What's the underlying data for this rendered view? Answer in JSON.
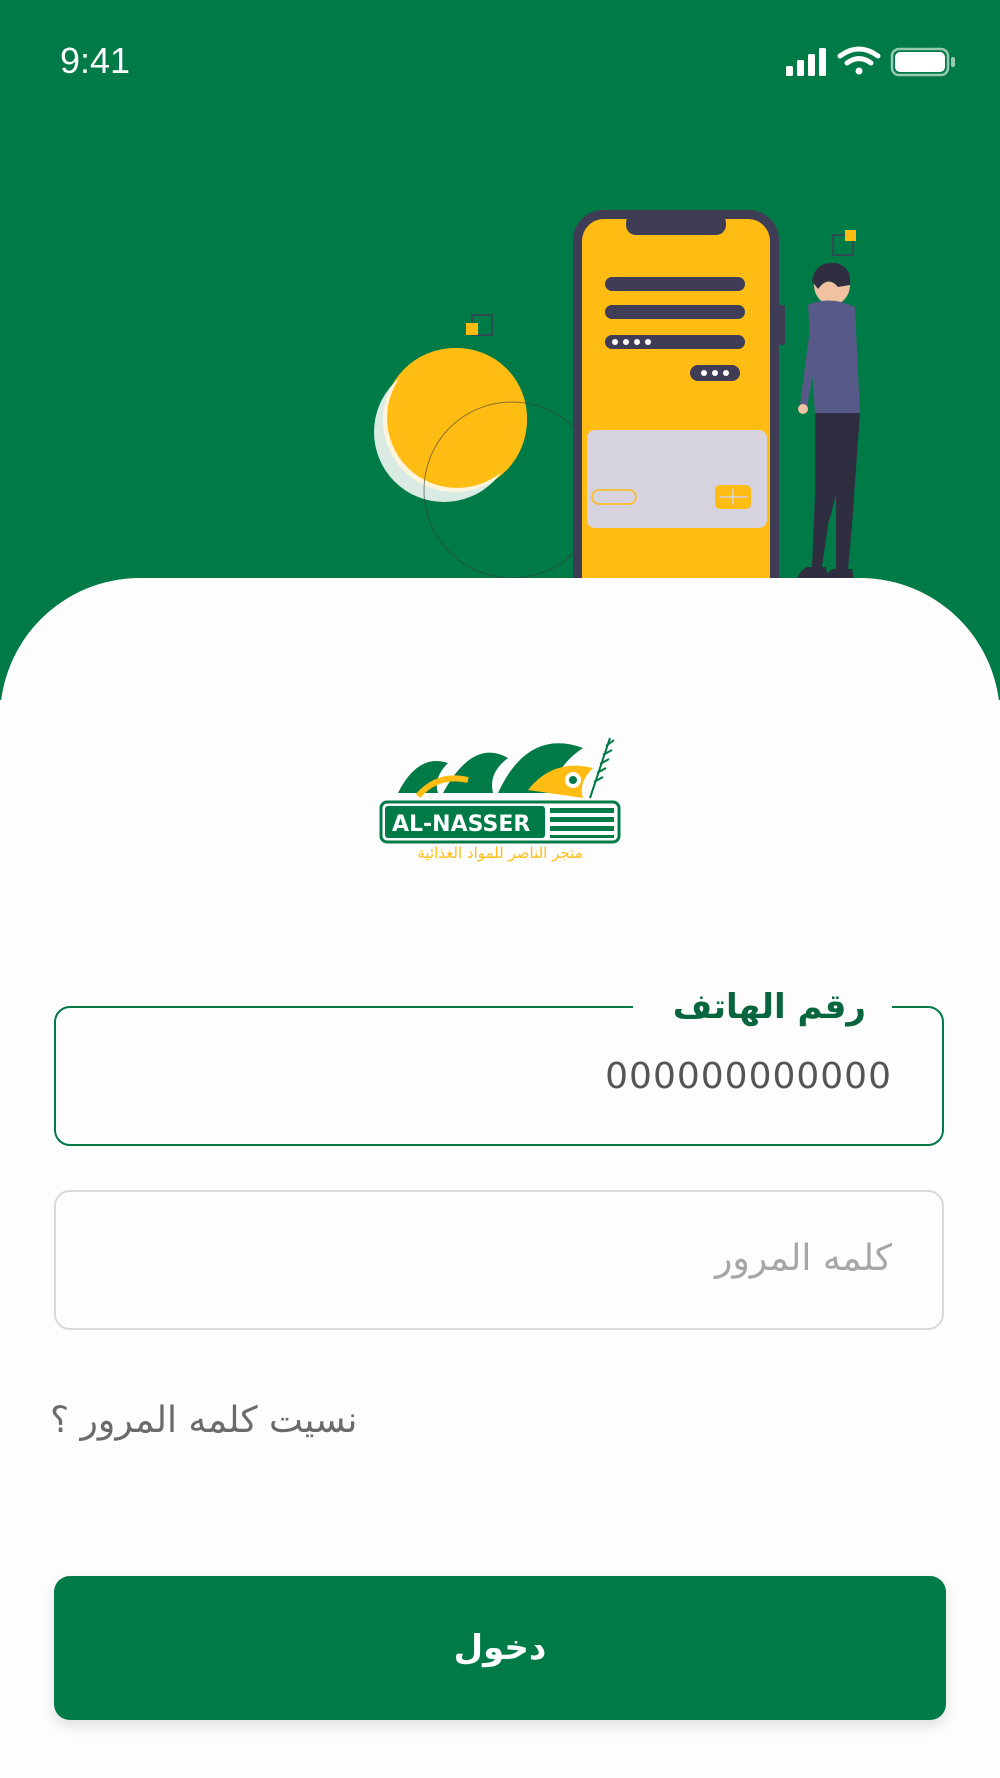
{
  "status_bar": {
    "time": "9:41",
    "icons": [
      "signal-icon",
      "wifi-icon",
      "battery-icon"
    ]
  },
  "hero": {
    "illustration": "phone-login-illustration"
  },
  "logo": {
    "wordmark": "AL-NASSER",
    "arabic_name": "الناصر",
    "tagline": "متجر الناصر للمواد الغذائية"
  },
  "form": {
    "phone": {
      "label": "رقم الهاتف",
      "value": "000000000000"
    },
    "password": {
      "placeholder": "كلمه المرور"
    },
    "forgot_password": "نسيت كلمه المرور ؟",
    "login_button": "دخول"
  },
  "colors": {
    "primary": "#007a47",
    "accent_yellow": "#ffbd14",
    "card_gray": "#d6d2de",
    "phone_frame": "#3f3d56",
    "person_shirt": "#575a89",
    "person_pants": "#2f2e41",
    "field_border": "#d9d9d9",
    "placeholder": "#a6a6a6"
  }
}
